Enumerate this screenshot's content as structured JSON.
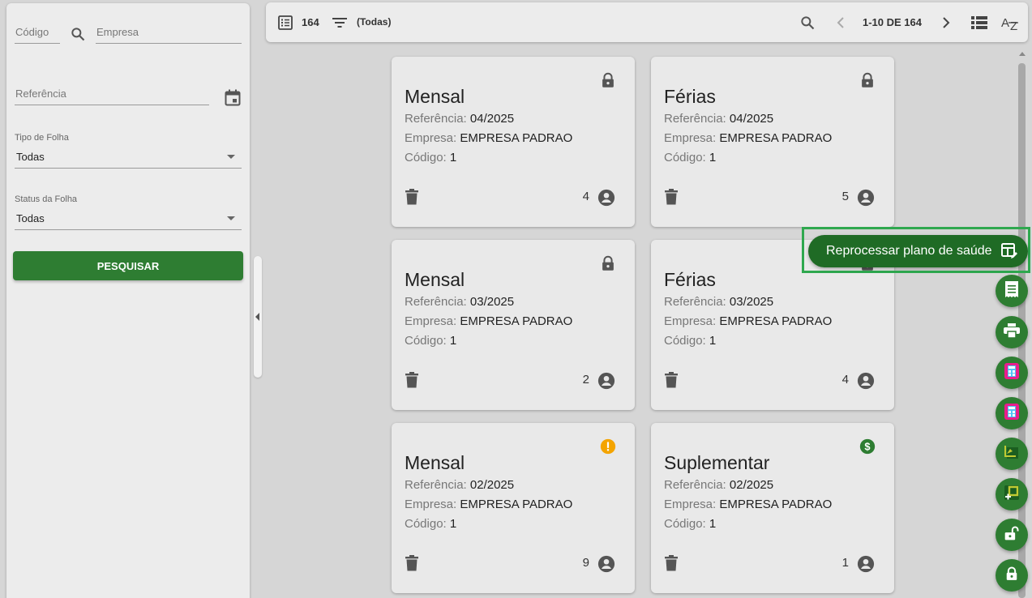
{
  "filters": {
    "codigo_placeholder": "Código",
    "empresa_placeholder": "Empresa",
    "referencia_placeholder": "Referência",
    "tipo_label": "Tipo de Folha",
    "tipo_value": "Todas",
    "status_label": "Status da Folha",
    "status_value": "Todas",
    "search_button": "PESQUISAR"
  },
  "toolbar": {
    "total": "164",
    "filter_label": "(Todas)",
    "pagination": "1-10 DE 164"
  },
  "cards": [
    {
      "title": "Mensal",
      "ref_label": "Referência:",
      "ref": "04/2025",
      "emp_label": "Empresa:",
      "emp": "EMPRESA PADRAO",
      "cod_label": "Código:",
      "cod": "1",
      "count": "4",
      "status": "lock"
    },
    {
      "title": "Férias",
      "ref_label": "Referência:",
      "ref": "04/2025",
      "emp_label": "Empresa:",
      "emp": "EMPRESA PADRAO",
      "cod_label": "Código:",
      "cod": "1",
      "count": "5",
      "status": "lock"
    },
    {
      "title": "Mensal",
      "ref_label": "Referência:",
      "ref": "03/2025",
      "emp_label": "Empresa:",
      "emp": "EMPRESA PADRAO",
      "cod_label": "Código:",
      "cod": "1",
      "count": "2",
      "status": "lock"
    },
    {
      "title": "Férias",
      "ref_label": "Referência:",
      "ref": "03/2025",
      "emp_label": "Empresa:",
      "emp": "EMPRESA PADRAO",
      "cod_label": "Código:",
      "cod": "1",
      "count": "4",
      "status": "lock"
    },
    {
      "title": "Mensal",
      "ref_label": "Referência:",
      "ref": "02/2025",
      "emp_label": "Empresa:",
      "emp": "EMPRESA PADRAO",
      "cod_label": "Código:",
      "cod": "1",
      "count": "9",
      "status": "warning"
    },
    {
      "title": "Suplementar",
      "ref_label": "Referência:",
      "ref": "02/2025",
      "emp_label": "Empresa:",
      "emp": "EMPRESA PADRAO",
      "cod_label": "Código:",
      "cod": "1",
      "count": "1",
      "status": "dollar"
    }
  ],
  "fab": {
    "extended_label": "Reprocessar plano de saúde",
    "actions": [
      "receipt-icon",
      "print-icon",
      "calculator-icon",
      "calculator-icon",
      "chart-icon",
      "add-plan-icon",
      "unlock-icon",
      "lock-icon"
    ]
  },
  "colors": {
    "primary": "#2e7d32",
    "fab_dark": "#1f6b25",
    "warning": "#f4a400",
    "highlight": "#2fa84f"
  }
}
